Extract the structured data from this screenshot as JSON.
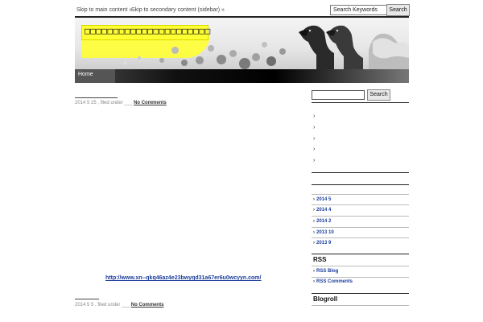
{
  "skip_links": {
    "main": "Skip to main content »",
    "secondary": "Skip to secondary content (sidebar) »"
  },
  "top_search": {
    "value": "Search Keywords",
    "button": "Search"
  },
  "header": {
    "site_title": "□□□□□□□□□□□□□□□□□□□□□□"
  },
  "nav": {
    "home": "Home"
  },
  "posts": [
    {
      "date": "2014 5 25 , filed under ___",
      "comments": "No Comments"
    },
    {
      "date": "2014 5 5 , filed under ___",
      "comments": "No Comments",
      "link": "http://www.xn--qkq46az4e23bwyqd31a67er6u0wcyyn.com/"
    }
  ],
  "sidebar": {
    "search_button": "Search",
    "blank_bullets": [
      "›",
      "›",
      "›",
      "›",
      "›"
    ],
    "archives": [
      "2014 5",
      "2014 4",
      "2014 2",
      "2013 10",
      "2013 9"
    ],
    "rss_heading": "RSS",
    "rss_items": [
      "RSS Blog",
      "RSS Comments"
    ],
    "blogroll_heading": "Blogroll"
  },
  "colors": {
    "accent_yellow": "#ffff33",
    "link": "#1a3d9e",
    "nav_bg": "#000000"
  }
}
